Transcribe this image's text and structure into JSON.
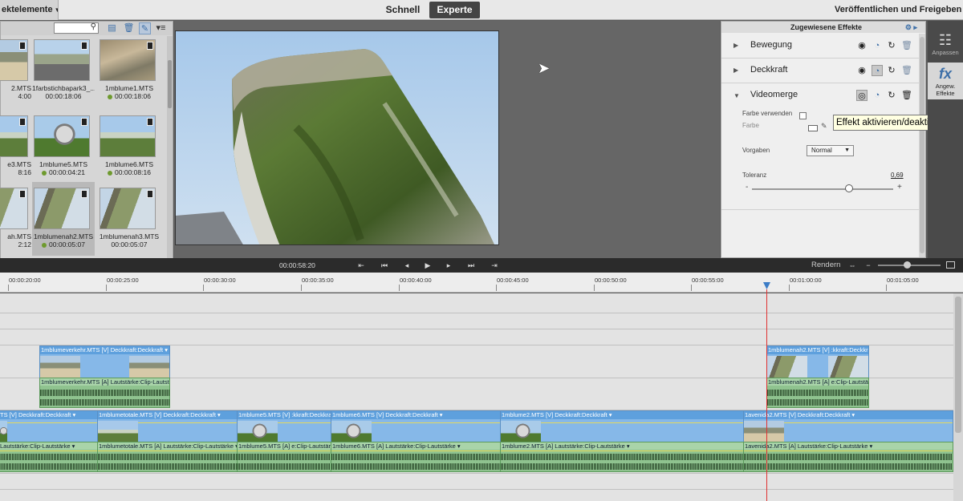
{
  "header": {
    "project_menu": "ektelemente",
    "tab_quick": "Schnell",
    "tab_expert": "Experte",
    "publish": "Veröffentlichen und Freigeben"
  },
  "media": {
    "clips": [
      {
        "name": "2.MTS",
        "duration": "4:00",
        "dot": false
      },
      {
        "name": "1farbstichbapark3_...",
        "duration": "00:00:18:06",
        "dot": false
      },
      {
        "name": "1mblume1.MTS",
        "duration": "00:00:18:06",
        "dot": true
      },
      {
        "name": "e3.MTS",
        "duration": "8:16",
        "dot": false
      },
      {
        "name": "1mblume5.MTS",
        "duration": "00:00:04:21",
        "dot": true
      },
      {
        "name": "1mblume6.MTS",
        "duration": "00:00:08:16",
        "dot": true
      },
      {
        "name": "ah.MTS",
        "duration": "2:12",
        "dot": false
      },
      {
        "name": "1mblumenah2.MTS",
        "duration": "00:00:05:07",
        "dot": true
      },
      {
        "name": "1mblumenah3.MTS",
        "duration": "00:00:05:07",
        "dot": false
      }
    ]
  },
  "effects": {
    "title": "Zugewiesene Effekte",
    "items": [
      {
        "label": "Bewegung"
      },
      {
        "label": "Deckkraft"
      },
      {
        "label": "Videomerge"
      }
    ],
    "use_color_label": "Farbe verwenden",
    "color_label": "Farbe",
    "presets_label": "Vorgaben",
    "preset_value": "Normal",
    "tolerance_label": "Toleranz",
    "tolerance_value": "0,69",
    "tolerance_fraction": 0.69,
    "minus": "-",
    "plus": "+",
    "tooltip": "Effekt aktivieren/deaktivieren"
  },
  "side": {
    "adjust_label": "Anpassen",
    "applied_label_1": "Angew.",
    "applied_label_2": "Effekte"
  },
  "transport": {
    "timecode": "00:00:58:20",
    "render": "Rendern"
  },
  "ruler": {
    "ticks": [
      "00:00:20:00",
      "00:00:25:00",
      "00:00:30:00",
      "00:00:35:00",
      "00:00:40:00",
      "00:00:45:00",
      "00:00:50:00",
      "00:00:55:00",
      "00:01:00:00",
      "00:01:05:00"
    ]
  },
  "timeline": {
    "upper_video": [
      {
        "name": "1mblumeverkehr.MTS [V]",
        "effect": "Deckkraft:Deckkraft ▾"
      },
      {
        "name": "1mblumenah2.MTS [V]",
        "effect": ":kkraft:Deckkraft ▾"
      }
    ],
    "upper_audio": [
      {
        "name": "1mblumeverkehr.MTS [A]",
        "effect": "Lautstärke:Clip-Lautstärke ▾"
      },
      {
        "name": "1mblumenah2.MTS [A]",
        "effect": "e:Clip-Lautstärke ▾"
      }
    ],
    "main_video": [
      {
        "name": "TS [V]",
        "effect": "Deckkraft:Deckkraft ▾"
      },
      {
        "name": "1mblumetotale.MTS [V]",
        "effect": "Deckkraft:Deckkraft ▾"
      },
      {
        "name": "1mblume5.MTS [V]",
        "effect": ":kkraft:Deckkraft ▾"
      },
      {
        "name": "1mblume6.MTS [V]",
        "effect": "Deckkraft:Deckkraft ▾"
      },
      {
        "name": "1mblume2.MTS [V]",
        "effect": "Deckkraft:Deckkraft ▾"
      },
      {
        "name": "1avenida2.MTS [V]",
        "effect": "Deckkraft:Deckkraft ▾"
      }
    ],
    "main_audio": [
      {
        "name": "",
        "effect": "Lautstärke:Clip-Lautstärke ▾"
      },
      {
        "name": "1mblumetotale.MTS [A]",
        "effect": "Lautstärke:Clip-Lautstärke ▾"
      },
      {
        "name": "1mblume5.MTS [A]",
        "effect": "e:Clip-Lautstärke ▾"
      },
      {
        "name": "1mblume6.MTS [A]",
        "effect": "Lautstärke:Clip-Lautstärke ▾"
      },
      {
        "name": "1mblume2.MTS [A]",
        "effect": "Lautstärke:Clip-Lautstärke ▾"
      },
      {
        "name": "1avenida2.MTS [A]",
        "effect": "Lautstärke:Clip-Lautstärke ▾"
      }
    ]
  }
}
